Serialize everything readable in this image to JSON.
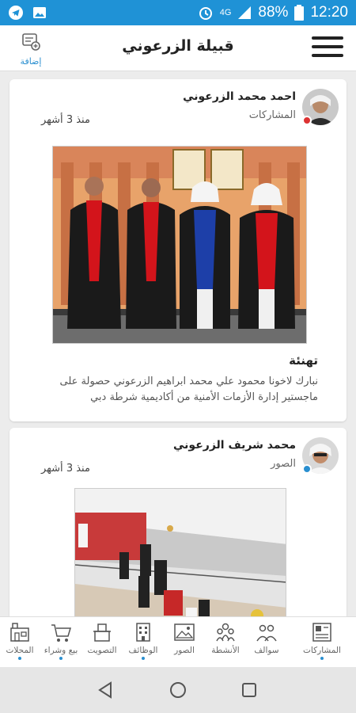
{
  "status": {
    "battery": "88%",
    "network": "4G",
    "time": "12:20"
  },
  "header": {
    "title": "قبيلة الزرعوني",
    "add_label": "إضافة"
  },
  "posts": [
    {
      "author": "احمد محمد الزرعوني",
      "category": "المشاركات",
      "time": "منذ 3 أشهر",
      "title": "تهنئة",
      "body": "نبارك لاخونا محمود علي محمد ابراهيم الزرعوني حصولة على ماجستير إدارة الأزمات الأمنية  من أكاديمية شرطة دبي"
    },
    {
      "author": "محمد شريف الزرعوني",
      "category": "الصور",
      "time": "منذ 3 أشهر"
    }
  ],
  "tabs": [
    {
      "label": "المحلات",
      "icon": "shops-icon"
    },
    {
      "label": "بيع وشراء",
      "icon": "cart-icon"
    },
    {
      "label": "التصويت",
      "icon": "vote-icon"
    },
    {
      "label": "الوظائف",
      "icon": "jobs-icon"
    },
    {
      "label": "الصور",
      "icon": "photos-icon"
    },
    {
      "label": "الأنشطة",
      "icon": "activities-icon"
    },
    {
      "label": "سوالف",
      "icon": "chat-icon"
    },
    {
      "label": "المشاركات",
      "icon": "posts-icon"
    }
  ],
  "colors": {
    "accent": "#1f92d6",
    "link": "#2a8fd0"
  }
}
